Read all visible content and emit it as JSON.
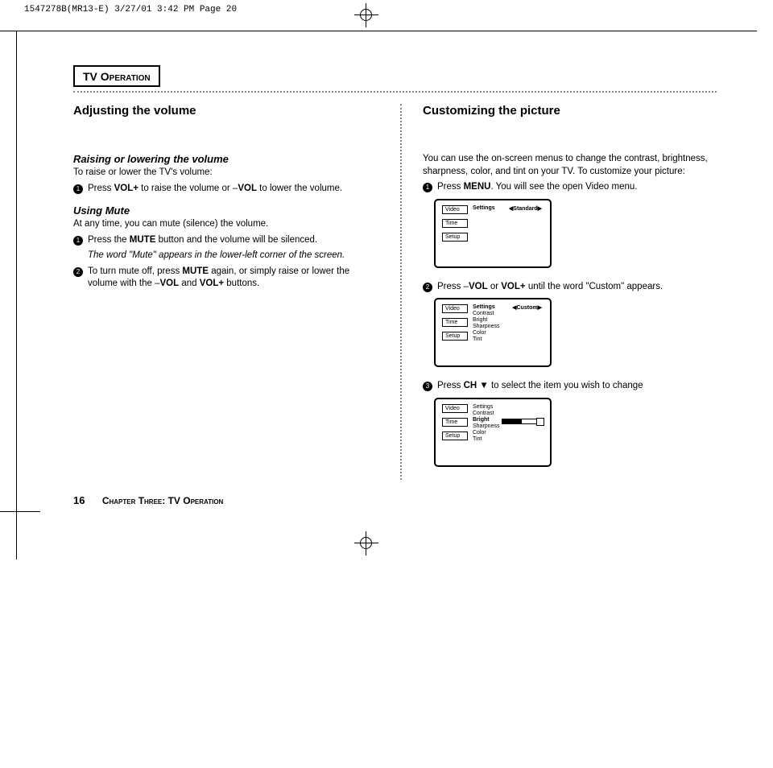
{
  "slug": "1547278B(MR13-E)  3/27/01 3:42 PM  Page 20",
  "section_title_prefix": "TV O",
  "section_title_rest": "peration",
  "left": {
    "h2": "Adjusting the volume",
    "sub1_h": "Raising or lowering the volume",
    "sub1_intro": "To raise or lower the TV's volume:",
    "sub1_step1_a": "Press ",
    "sub1_step1_b": "VOL+",
    "sub1_step1_c": " to raise the volume or  –",
    "sub1_step1_d": "VOL",
    "sub1_step1_e": " to lower the volume.",
    "sub2_h": "Using Mute",
    "sub2_intro": "At any time, you can mute (silence) the volume.",
    "sub2_step1_a": "Press the ",
    "sub2_step1_b": "MUTE",
    "sub2_step1_c": " button and the volume will be silenced.",
    "sub2_note": "The word \"Mute\" appears in the lower-left corner of the screen.",
    "sub2_step2_a": "To turn mute off, press ",
    "sub2_step2_b": "MUTE",
    "sub2_step2_c": " again, or simply raise or lower the volume with the –",
    "sub2_step2_d": "VOL",
    "sub2_step2_e": " and ",
    "sub2_step2_f": "VOL+",
    "sub2_step2_g": " buttons."
  },
  "right": {
    "h2": "Customizing the picture",
    "intro": "You can use the on-screen menus to change the contrast, brightness, sharpness, color, and tint on your TV. To customize your picture:",
    "s1_a": "Press ",
    "s1_b": "MENU",
    "s1_c": ". You will see the open Video menu.",
    "s2_a": "Press –",
    "s2_b": "VOL",
    "s2_c": " or ",
    "s2_d": "VOL+",
    "s2_e": " until the word \"Custom\" appears.",
    "s3_a": "Press ",
    "s3_b": "CH",
    "s3_c": " ▼ to select the item you wish to change"
  },
  "menu": {
    "video": "Video",
    "time": "Time",
    "setup": "Setup",
    "settings": "Settings",
    "standard": "◀Standard▶",
    "custom": "◀Custom▶",
    "contrast": "Contrast",
    "bright": "Bright",
    "sharpness": "Sharpness",
    "color": "Color",
    "tint": "Tint"
  },
  "footer": {
    "page": "16",
    "chapter_a": "Chapter Three: TV O",
    "chapter_b": "peration"
  }
}
